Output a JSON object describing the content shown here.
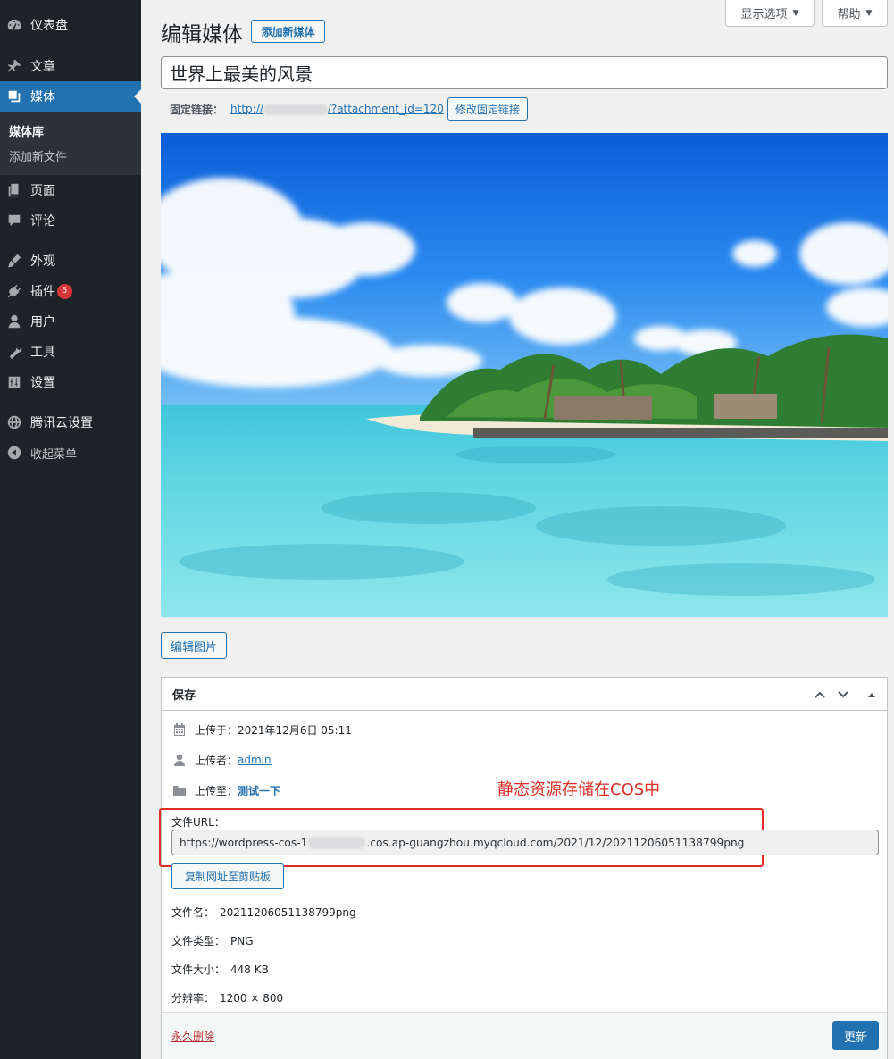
{
  "sidebar": {
    "items": [
      {
        "label": "仪表盘",
        "icon": "dashboard-icon"
      },
      {
        "label": "文章",
        "icon": "pin-icon"
      },
      {
        "label": "媒体",
        "icon": "media-icon"
      },
      {
        "label": "页面",
        "icon": "pages-icon"
      },
      {
        "label": "评论",
        "icon": "comment-icon"
      },
      {
        "label": "外观",
        "icon": "brush-icon"
      },
      {
        "label": "插件",
        "icon": "plugin-icon",
        "badge": "5"
      },
      {
        "label": "用户",
        "icon": "user-icon"
      },
      {
        "label": "工具",
        "icon": "wrench-icon"
      },
      {
        "label": "设置",
        "icon": "settings-icon"
      },
      {
        "label": "腾讯云设置",
        "icon": "globe-icon"
      },
      {
        "label": "收起菜单",
        "icon": "collapse-icon"
      }
    ],
    "submenu": [
      "媒体库",
      "添加新文件"
    ]
  },
  "top_tabs": {
    "screen_options": "显示选项",
    "help": "帮助"
  },
  "header": {
    "title": "编辑媒体",
    "add_new": "添加新媒体"
  },
  "title_value": "世界上最美的风景",
  "permalink": {
    "label": "固定链接：",
    "url_prefix": "http://",
    "url_suffix": "/?attachment_id=120",
    "edit_button": "修改固定链接"
  },
  "edit_image_button": "编辑图片",
  "save_box": {
    "title": "保存",
    "uploaded_on_label": "上传于：",
    "uploaded_on_value": "2021年12月6日 05:11",
    "uploaded_by_label": "上传者：",
    "uploaded_by_value": "admin",
    "uploaded_to_label": "上传至：",
    "uploaded_to_value": "测试一下",
    "annotation": "静态资源存储在COS中",
    "file_url_label": "文件URL：",
    "file_url_prefix": "https://wordpress-cos-1",
    "file_url_suffix": ".cos.ap-guangzhou.myqcloud.com/2021/12/20211206051138799png",
    "copy_button": "复制网址至剪贴板",
    "file_name_label": "文件名：",
    "file_name_value": "20211206051138799png",
    "file_type_label": "文件类型：",
    "file_type_value": "PNG",
    "file_size_label": "文件大小：",
    "file_size_value": "448 KB",
    "dimensions_label": "分辨率：",
    "dimensions_value": "1200 × 800",
    "delete_link": "永久删除",
    "update_button": "更新"
  },
  "colors": {
    "sidebar_bg": "#1d2327",
    "accent": "#2271b1",
    "annotation_red": "#e02e24",
    "delete_red": "#b32d2e"
  }
}
